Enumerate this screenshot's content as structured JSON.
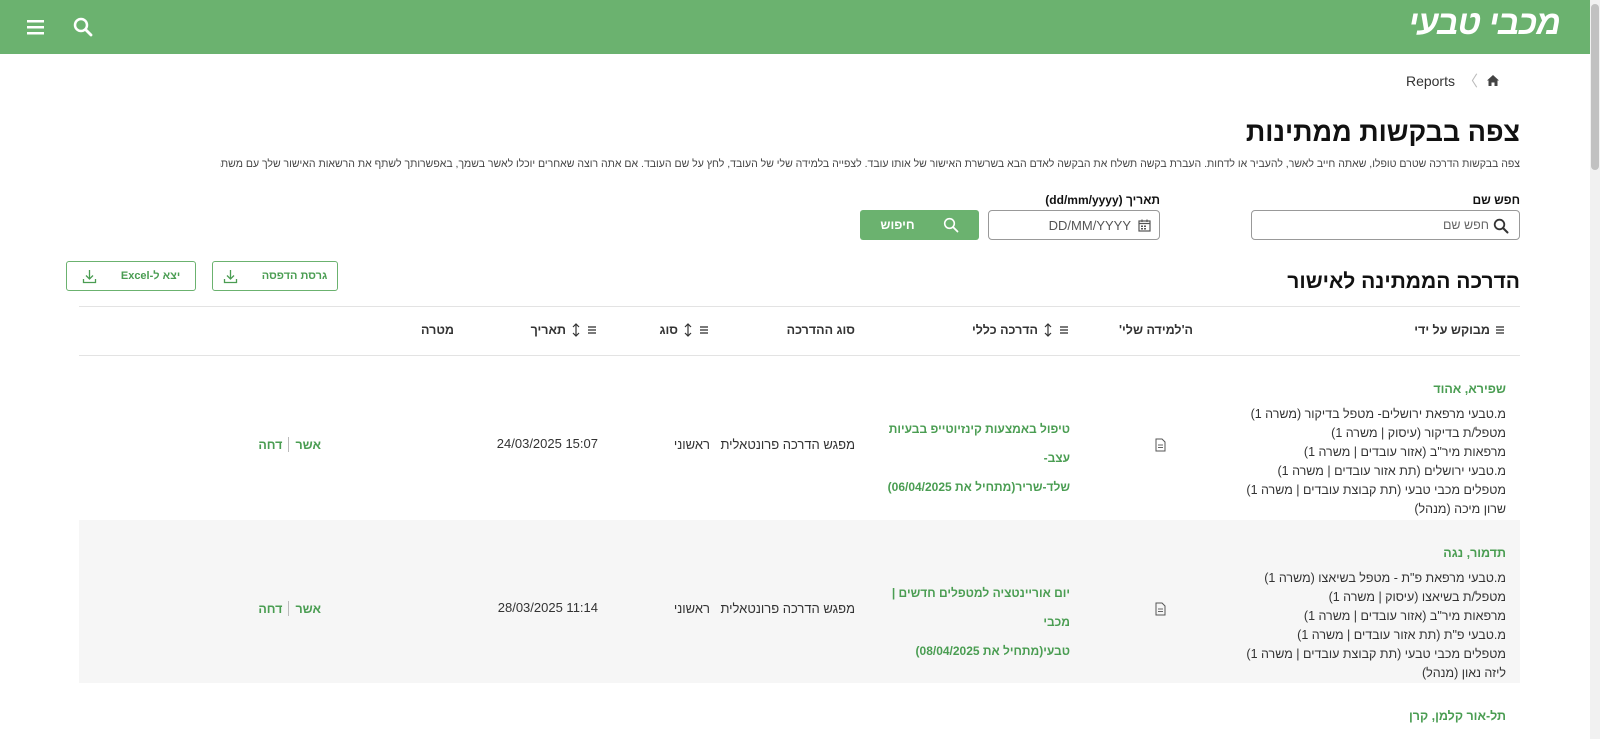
{
  "header": {
    "logo_text": "מכבי טבעי",
    "brand_color": "#6bb26f",
    "menu_icon": "hamburger-icon",
    "search_icon": "search-icon"
  },
  "breadcrumb": {
    "current": "Reports",
    "home_icon": "home-icon"
  },
  "page": {
    "title": "צפה בבקשות ממתינות",
    "description": "צפה בבקשות הדרכה שטרם טופלו, שאתה חייב לאשר, להעביר או לדחות. העברת בקשה תשלח את הבקשה לאדם הבא בשרשרת האישור של אותו עובד. לצפייה בלמידה שלי של העובד, לחץ על שם העובד. אם אתה רוצה שאחרים יוכלו לאשר בשמך, באפשרותך לשתף את הרשאות האישור שלך עם משתמשים שבשבילם אתה:"
  },
  "filters": {
    "name_label": "חפש שם",
    "name_placeholder": "חפש שם",
    "date_label": "תאריך (dd/mm/yyyy)",
    "date_placeholder": "DD/MM/YYYY",
    "search_button": "חיפוש"
  },
  "section": {
    "title": "הדרכה הממתינה לאישור",
    "print_button": "גרסת הדפסה",
    "excel_button": "יצא ל-Excel"
  },
  "table": {
    "columns": {
      "requester": "מבוקש על ידי",
      "my_learning": "ה'למידה שלי'",
      "general_training": "הדרכה כללי",
      "training_type": "סוג ההדרכה",
      "type": "סוג",
      "date": "תאריך",
      "goal": "מטרה"
    },
    "rows": [
      {
        "name": "שפירא, אהוד",
        "details": [
          "מ.טבעי מרפאת ירושלים- מטפל בדיקור (משרה 1)",
          "מטפל/ת בדיקור (עיסוק | משרה 1)",
          "מרפאות מיר\"ב (אזור עובדים | משרה 1)",
          "מ.טבעי ירושלים (תת אזור עובדים | משרה 1)",
          "מטפלים מכבי טבעי (תת קבוצת עובדים | משרה 1)",
          "שרון מיכה (מנהל)"
        ],
        "course_line1": "טיפול באמצעות קינזיוטייפ בבעיות עצב-",
        "course_line2": "שלד-שריר(מתחיל את 06/04/2025)",
        "training_type": "מפגש הדרכה פרונטאלית",
        "type": "ראשוני",
        "date": "24/03/2025 15:07",
        "approve": "אשר",
        "reject": "דחה"
      },
      {
        "name": "תדמור, נגה",
        "details": [
          "מ.טבעי מרפאת פ\"ת - מטפל בשיאצו (משרה 1)",
          "מטפל/ת בשיאצו (עיסוק | משרה 1)",
          "מרפאות מיר\"ב (אזור עובדים | משרה 1)",
          "מ.טבעי פ\"ת (תת אזור עובדים | משרה 1)",
          "מטפלים מכבי טבעי (תת קבוצת עובדים | משרה 1)",
          "ליזה נאון (מנהל)"
        ],
        "course_line1": "יום אוריינטציה למטפלים חדשים | מכבי",
        "course_line2": "טבעי(מתחיל את 08/04/2025)",
        "training_type": "מפגש הדרכה פרונטאלית",
        "type": "ראשוני",
        "date": "28/03/2025 11:14",
        "approve": "אשר",
        "reject": "דחה"
      },
      {
        "name": "תל-אור קלמן, קרן"
      }
    ]
  }
}
